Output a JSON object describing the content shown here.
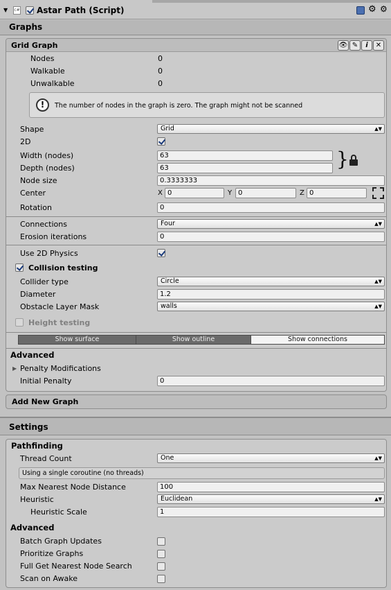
{
  "header": {
    "title": "Astar Path (Script)",
    "script_glyph": "c#"
  },
  "sections": {
    "graphs": "Graphs",
    "settings": "Settings"
  },
  "grid_graph": {
    "title": "Grid Graph",
    "nodes_label": "Nodes",
    "nodes": "0",
    "walkable_label": "Walkable",
    "walkable": "0",
    "unwalkable_label": "Unwalkable",
    "unwalkable": "0",
    "warning": "The number of nodes in the graph is zero. The graph might not be scanned",
    "shape_label": "Shape",
    "shape": "Grid",
    "twod_label": "2D",
    "width_label": "Width (nodes)",
    "width": "63",
    "depth_label": "Depth (nodes)",
    "depth": "63",
    "node_size_label": "Node size",
    "node_size": "0.3333333",
    "center_label": "Center",
    "x_label": "X",
    "x": "0",
    "y_label": "Y",
    "y": "0",
    "z_label": "Z",
    "z": "0",
    "rotation_label": "Rotation",
    "rotation": "0",
    "connections_label": "Connections",
    "connections": "Four",
    "erosion_label": "Erosion iterations",
    "erosion": "0",
    "use2d_label": "Use 2D Physics",
    "collision_label": "Collision testing",
    "collider_type_label": "Collider type",
    "collider_type": "Circle",
    "diameter_label": "Diameter",
    "diameter": "1.2",
    "mask_label": "Obstacle Layer Mask",
    "mask": "walls",
    "height_label": "Height testing",
    "show_surface": "Show surface",
    "show_outline": "Show outline",
    "show_connections": "Show connections",
    "advanced_label": "Advanced",
    "penalty_mod_label": "Penalty Modifications",
    "initial_penalty_label": "Initial Penalty",
    "initial_penalty": "0"
  },
  "add_graph": "Add New Graph",
  "pathfinding": {
    "title": "Pathfinding",
    "thread_count_label": "Thread Count",
    "thread_count": "One",
    "thread_info": "Using a single coroutine (no threads)",
    "max_nearest_label": "Max Nearest Node Distance",
    "max_nearest": "100",
    "heuristic_label": "Heuristic",
    "heuristic": "Euclidean",
    "heuristic_scale_label": "Heuristic Scale",
    "heuristic_scale": "1",
    "advanced_label": "Advanced",
    "batch_label": "Batch Graph Updates",
    "prioritize_label": "Prioritize Graphs",
    "full_nearest_label": "Full Get Nearest Node Search",
    "scan_awake_label": "Scan on Awake"
  },
  "icons": [
    "foldout-arrow-icon",
    "script-icon",
    "help-book-icon",
    "gear-icon",
    "eye-icon",
    "pencil-icon",
    "info-icon",
    "close-icon",
    "lock-icon",
    "warning-icon",
    "move-tool-icon"
  ]
}
